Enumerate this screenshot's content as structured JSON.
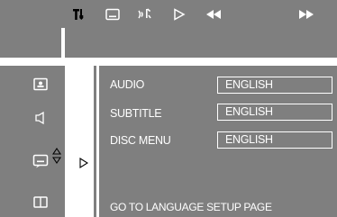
{
  "toolbar": {
    "icons": [
      "settings-icon",
      "subtitle-icon",
      "audio-icon",
      "play-icon",
      "rewind-icon",
      "fast-forward-icon"
    ]
  },
  "sidebar": {
    "items": [
      {
        "icon": "general-setup-icon"
      },
      {
        "icon": "speaker-icon"
      },
      {
        "icon": "language-icon",
        "selected": true
      },
      {
        "icon": "book-icon"
      }
    ]
  },
  "language_setup": {
    "rows": [
      {
        "label": "AUDIO",
        "value": "ENGLISH"
      },
      {
        "label": "SUBTITLE",
        "value": "ENGLISH"
      },
      {
        "label": "DISC MENU",
        "value": "ENGLISH"
      }
    ],
    "footer": "GO TO LANGUAGE SETUP PAGE"
  },
  "colors": {
    "panel": "#7f7f7f",
    "text": "#ffffff",
    "background": "#ffffff"
  }
}
